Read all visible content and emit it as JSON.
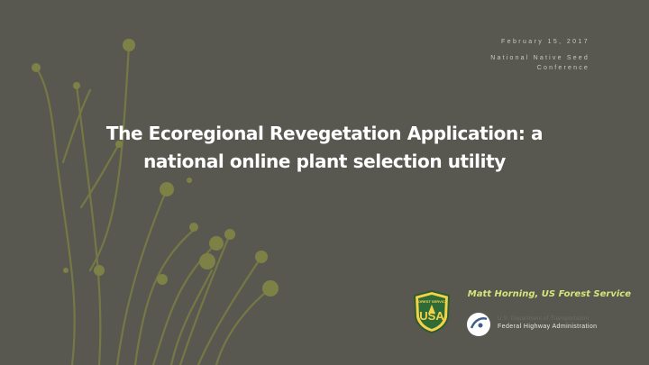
{
  "header": {
    "date": "February 15, 2017",
    "conference": "National Native Seed Conference"
  },
  "title": {
    "line1": "The Ecoregional Revegetation Application: a",
    "line2": "national online plant selection utility"
  },
  "presenter": "Matt Horning, US Forest Service",
  "logos": {
    "usfs_label": "FOREST SERVICE",
    "usfs_letters": "USA",
    "dot_dept": "U.S. Department of Transportation",
    "dot_agency": "Federal Highway Administration"
  },
  "colors": {
    "background": "#595850",
    "plant": "#7c7f45",
    "accent": "#d4e57a"
  }
}
